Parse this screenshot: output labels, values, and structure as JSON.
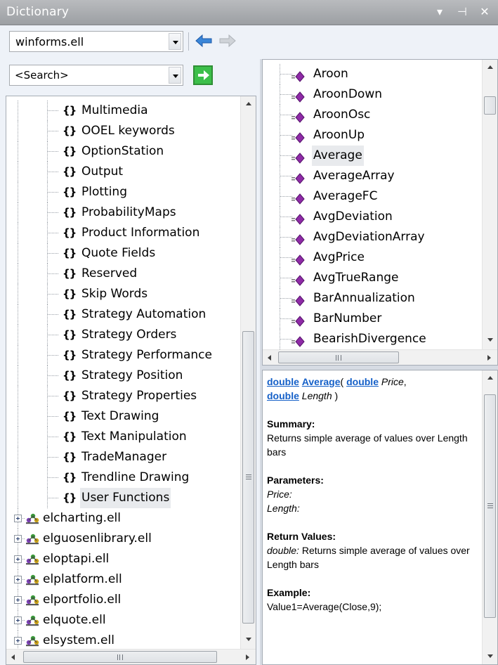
{
  "window": {
    "title": "Dictionary",
    "buttons": {
      "dropdown": "▾",
      "pin": "⊣",
      "close": "✕"
    }
  },
  "toolbar": {
    "library_combo_value": "winforms.ell",
    "back_icon": "arrow-left-blue",
    "forward_icon": "arrow-right-gray"
  },
  "search": {
    "combo_value": "<Search>",
    "go_icon": "green-arrow-go"
  },
  "tree": {
    "categories": [
      "Multimedia",
      "OOEL keywords",
      "OptionStation",
      "Output",
      "Plotting",
      "ProbabilityMaps",
      "Product Information",
      "Quote Fields",
      "Reserved",
      "Skip Words",
      "Strategy Automation",
      "Strategy Orders",
      "Strategy Performance",
      "Strategy Position",
      "Strategy Properties",
      "Text Drawing",
      "Text Manipulation",
      "TradeManager",
      "Trendline Drawing",
      "User Functions"
    ],
    "selected_category": "User Functions",
    "category_icon_glyph": "{}",
    "libraries": [
      "elcharting.ell",
      "elguosenlibrary.ell",
      "eloptapi.ell",
      "elplatform.ell",
      "elportfolio.ell",
      "elquote.ell",
      "elsystem.ell"
    ],
    "expander_glyph": "+"
  },
  "functions": {
    "items": [
      "Aroon",
      "AroonDown",
      "AroonOsc",
      "AroonUp",
      "Average",
      "AverageArray",
      "AverageFC",
      "AvgDeviation",
      "AvgDeviationArray",
      "AvgPrice",
      "AvgTrueRange",
      "BarAnnualization",
      "BarNumber",
      "BearishDivergence"
    ],
    "selected": "Average",
    "item_icon": "purple-diamond-function-icon"
  },
  "help": {
    "signature": {
      "return_type": "double",
      "name": "Average",
      "open": "( ",
      "param1_type": "double",
      "param1_name": "Price",
      "comma": ",",
      "param2_type": "double",
      "param2_name": "Length",
      "close": " )"
    },
    "summary_heading": "Summary:",
    "summary_text": "Returns simple average of values over Length bars",
    "parameters_heading": "Parameters:",
    "param1_label": "Price:",
    "param2_label": "Length:",
    "return_heading": "Return Values:",
    "return_type": "double:",
    "return_text": " Returns simple average of values over Length bars",
    "example_heading": "Example:",
    "example_text": "Value1=Average(Close,9);"
  },
  "scrollbars": {
    "hthumb_grip": "III"
  }
}
